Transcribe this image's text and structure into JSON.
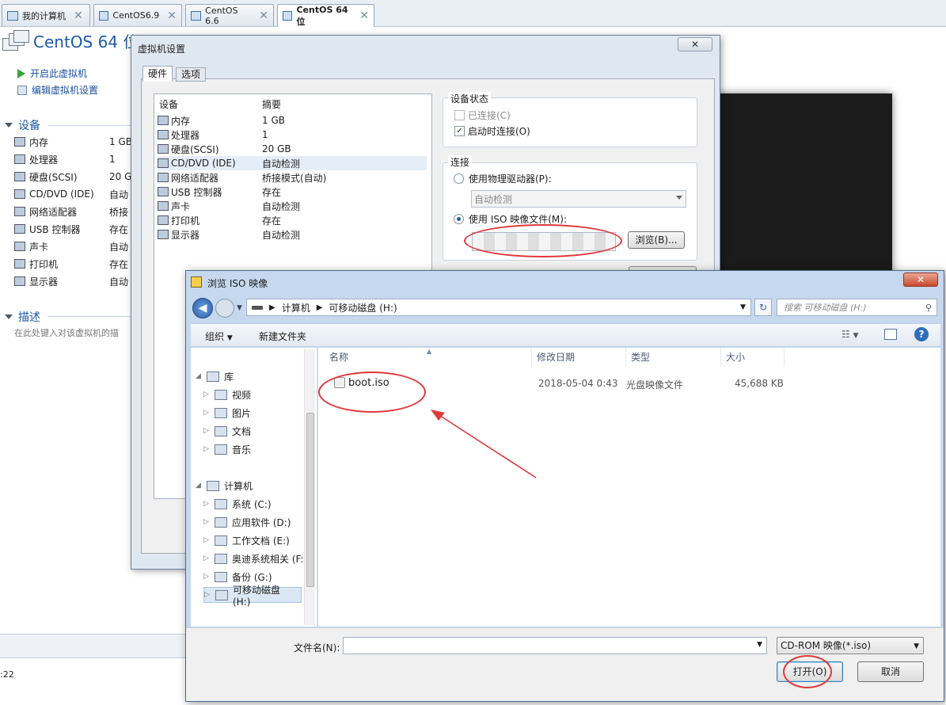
{
  "tabs": [
    {
      "label": "我的计算机",
      "active": false
    },
    {
      "label": "CentOS6.9",
      "active": false
    },
    {
      "label": "CentOS 6.6",
      "active": false
    },
    {
      "label": "CentOS 64 位",
      "active": true
    }
  ],
  "vm": {
    "title": "CentOS 64 位",
    "power_on": "开启此虚拟机",
    "edit_settings": "编辑虚拟机设置",
    "devices_header": "设备",
    "devices": [
      {
        "name": "内存",
        "value": "1 GB",
        "icon": "memory-icon"
      },
      {
        "name": "处理器",
        "value": "1",
        "icon": "cpu-icon"
      },
      {
        "name": "硬盘(SCSI)",
        "value": "20 G",
        "icon": "harddisk-icon"
      },
      {
        "name": "CD/DVD (IDE)",
        "value": "自动",
        "icon": "cdrom-icon"
      },
      {
        "name": "网络适配器",
        "value": "桥接",
        "icon": "network-icon"
      },
      {
        "name": "USB 控制器",
        "value": "存在",
        "icon": "usb-icon"
      },
      {
        "name": "声卡",
        "value": "自动",
        "icon": "sound-icon"
      },
      {
        "name": "打印机",
        "value": "存在",
        "icon": "printer-icon"
      },
      {
        "name": "显示器",
        "value": "自动",
        "icon": "display-icon"
      }
    ],
    "desc_header": "描述",
    "desc_placeholder": "在此处键入对该虚拟机的描",
    "status_fragment": ":22"
  },
  "settings": {
    "title": "虚拟机设置",
    "close_label": "✕",
    "tabs": [
      "硬件",
      "选项"
    ],
    "col_device": "设备",
    "col_summary": "摘要",
    "hardware": [
      {
        "name": "内存",
        "summary": "1 GB",
        "icon": "memory-icon"
      },
      {
        "name": "处理器",
        "summary": "1",
        "icon": "cpu-icon"
      },
      {
        "name": "硬盘(SCSI)",
        "summary": "20 GB",
        "icon": "harddisk-icon"
      },
      {
        "name": "CD/DVD (IDE)",
        "summary": "自动检测",
        "icon": "cdrom-icon"
      },
      {
        "name": "网络适配器",
        "summary": "桥接模式(自动)",
        "icon": "network-icon"
      },
      {
        "name": "USB 控制器",
        "summary": "存在",
        "icon": "usb-icon"
      },
      {
        "name": "声卡",
        "summary": "自动检测",
        "icon": "sound-icon"
      },
      {
        "name": "打印机",
        "summary": "存在",
        "icon": "printer-icon"
      },
      {
        "name": "显示器",
        "summary": "自动检测",
        "icon": "display-icon"
      }
    ],
    "selected_index": 3,
    "device_status": "设备状态",
    "connected": "已连接(C)",
    "connect_at_power_on": "启动时连接(O)",
    "connection": "连接",
    "use_physical": "使用物理驱动器(P):",
    "physical_value": "自动检测",
    "use_iso": "使用 ISO 映像文件(M):",
    "browse_button": "浏览(B)..."
  },
  "browse": {
    "title": "浏览 ISO 映像",
    "close_label": "✕",
    "breadcrumb": [
      "计算机",
      "可移动磁盘 (H:)"
    ],
    "search_placeholder": "搜索 可移动磁盘 (H:)",
    "organize": "组织",
    "new_folder": "新建文件夹",
    "columns": {
      "name": "名称",
      "modified": "修改日期",
      "type": "类型",
      "size": "大小"
    },
    "files": [
      {
        "name": "boot.iso",
        "modified": "2018-05-04 0:43",
        "type": "光盘映像文件",
        "size": "45,688 KB"
      }
    ],
    "tree": [
      {
        "label": "库",
        "icon": "library-icon",
        "level": 0
      },
      {
        "label": "视频",
        "icon": "video-icon",
        "level": 1
      },
      {
        "label": "图片",
        "icon": "pictures-icon",
        "level": 1
      },
      {
        "label": "文档",
        "icon": "documents-icon",
        "level": 1
      },
      {
        "label": "音乐",
        "icon": "music-icon",
        "level": 1
      },
      {
        "label": "计算机",
        "icon": "computer-icon",
        "level": 0
      },
      {
        "label": "系统 (C:)",
        "icon": "drive-icon",
        "level": 1
      },
      {
        "label": "应用软件 (D:)",
        "icon": "drive-icon",
        "level": 1
      },
      {
        "label": "工作文档 (E:)",
        "icon": "drive-icon",
        "level": 1
      },
      {
        "label": "奥迪系统相关 (F:",
        "icon": "drive-icon",
        "level": 1
      },
      {
        "label": "备份 (G:)",
        "icon": "drive-icon",
        "level": 1
      },
      {
        "label": "可移动磁盘 (H:)",
        "icon": "usb-drive-icon",
        "level": 1
      }
    ],
    "filename_label": "文件名(N):",
    "filename_value": "",
    "filter": "CD-ROM 映像(*.iso)",
    "open_button": "打开(O)",
    "cancel_button": "取消"
  },
  "colors": {
    "accent": "#1c5aa8",
    "annotation": "#e0393b"
  }
}
